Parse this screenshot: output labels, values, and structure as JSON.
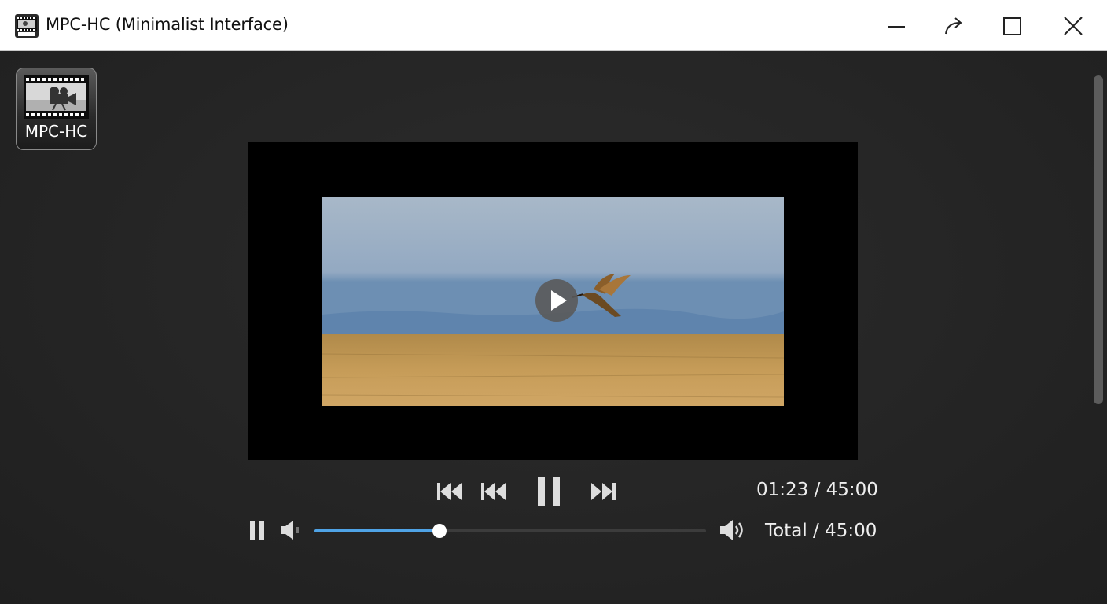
{
  "window": {
    "title": "MPC-HC (Minimalist Interface)",
    "controls": [
      "minimize-icon",
      "redo-arrow-icon",
      "maximize-icon",
      "close-icon"
    ]
  },
  "desktop_icon": {
    "label": "MPC-HC",
    "icon": "film-camera-icon"
  },
  "player": {
    "current_time": "01:23 / 45:00",
    "total_time": "Total / 45:00",
    "seek_progress": 0.32,
    "state_overlay_icon": "play-icon",
    "controls": [
      "skip-back-icon",
      "rewind-icon",
      "pause-icon",
      "skip-forward-icon"
    ],
    "secondary_controls": [
      "pause-small-icon",
      "volume-low-icon",
      "volume-high-icon"
    ]
  },
  "colors": {
    "accent": "#4fa3e6",
    "background": "#262626",
    "titlebar": "#ffffff"
  }
}
